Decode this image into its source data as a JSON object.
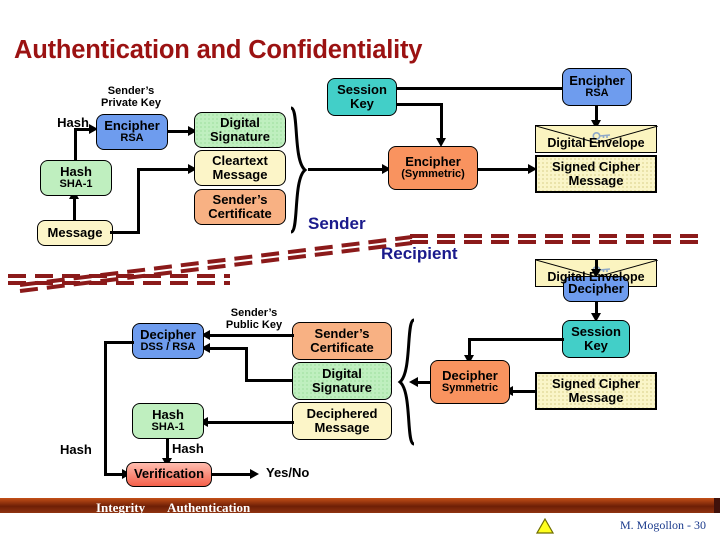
{
  "slide": {
    "title": "Authentication and Confidentiality",
    "title_color": "#9B1212",
    "background": "#ffffff"
  },
  "sender_section": {
    "section_label": "Sender",
    "labels": {
      "senders_private_key": "Sender's\nPrivate Key",
      "senders_private_key_line1": "Sender’s",
      "senders_private_key_line2": "Private Key",
      "hash_arrow_label": "Hash"
    },
    "boxes": {
      "message": {
        "line1": "Message",
        "line2": "",
        "color": "#FCF5C8"
      },
      "hash_sha1": {
        "line1": "Hash",
        "line2": "SHA-1",
        "color": "#BFEFBF"
      },
      "encipher_rsa": {
        "line1": "Encipher",
        "line2": "RSA",
        "color": "#6E9CEE"
      },
      "digital_signature": {
        "line1": "Digital",
        "line2": "Signature",
        "color": "#BFEFBF"
      },
      "cleartext_message": {
        "line1": "Cleartext",
        "line2": "Message",
        "color": "#FCF5C8"
      },
      "senders_certificate": {
        "line1": "Sender’s",
        "line2": "Certificate",
        "color": "#F8B183"
      },
      "session_key": {
        "line1": "Session",
        "line2": "Key",
        "color": "#42CFC8"
      },
      "encipher_symmetric": {
        "line1": "Encipher",
        "line2": "(Symmetric)",
        "color": "#F9935F"
      },
      "encipher_rsa_key": {
        "line1": "Encipher",
        "line2": "RSA",
        "color": "#6E9CEE"
      },
      "digital_envelope": {
        "line1": "Digital Envelope",
        "color": "#FBF4C0"
      },
      "signed_cipher_message": {
        "line1": "Signed Cipher",
        "line2": "Message",
        "color": "#FAF5C8"
      }
    }
  },
  "recipient_section": {
    "section_label": "Recipient",
    "labels": {
      "senders_public_key_line1": "Sender’s",
      "senders_public_key_line2": "Public Key",
      "hash_left_label": "Hash",
      "hash_mid_label": "Hash",
      "yes_no": "Yes/No"
    },
    "boxes": {
      "digital_envelope": {
        "line1": "Digital Envelope",
        "color": "#FBF4C0"
      },
      "decipher": {
        "line1": "Decipher",
        "line2": "",
        "color": "#6E9CEE"
      },
      "session_key": {
        "line1": "Session",
        "line2": "Key",
        "color": "#42CFC8"
      },
      "signed_cipher_message": {
        "line1": "Signed Cipher",
        "line2": "Message",
        "color": "#FAF5C8"
      },
      "decipher_symmetric": {
        "line1": "Decipher",
        "line2": "Symmetric",
        "color": "#F9935F"
      },
      "senders_certificate": {
        "line1": "Sender’s",
        "line2": "Certificate",
        "color": "#F8B183"
      },
      "digital_signature": {
        "line1": "Digital",
        "line2": "Signature",
        "color": "#BFEFBF"
      },
      "deciphered_message": {
        "line1": "Deciphered",
        "line2": "Message",
        "color": "#FCF5C8"
      },
      "decipher_dss_rsa": {
        "line1": "Decipher",
        "line2": "DSS / RSA",
        "color": "#6E9CEE"
      },
      "hash_sha1": {
        "line1": "Hash",
        "line2": "SHA-1",
        "color": "#BFEFBF"
      },
      "verification": {
        "line1": "Verification",
        "line2": "",
        "color": "#F4604A"
      }
    }
  },
  "divider": {
    "style": "dashed-double",
    "color": "#8B1A1A"
  },
  "footer": {
    "left_label_1": "Integrity",
    "left_label_2": "Authentication",
    "credit": "M. Mogollon - 30",
    "bar_color": "#6E1F06",
    "warning_icon": "warning-triangle-icon"
  }
}
